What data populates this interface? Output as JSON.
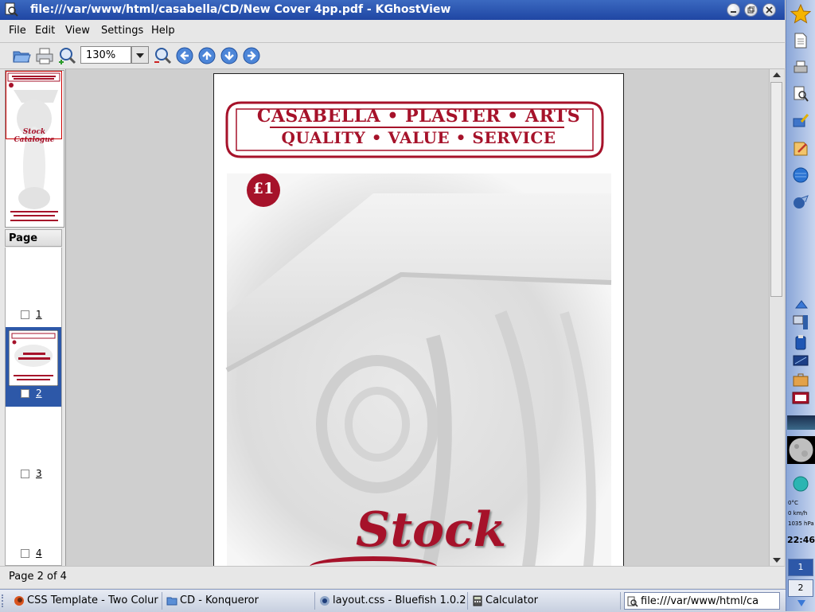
{
  "window": {
    "title": "file:///var/www/html/casabella/CD/New Cover 4pp.pdf - KGhostView"
  },
  "menubar": {
    "items": [
      "File",
      "Edit",
      "View",
      "Settings",
      "Help"
    ]
  },
  "toolbar": {
    "zoom_value": "130%"
  },
  "thumbs": {
    "header": "Page",
    "pages": [
      {
        "label": "1",
        "selected": false
      },
      {
        "label": "2",
        "selected": true
      },
      {
        "label": "3",
        "selected": false
      },
      {
        "label": "4",
        "selected": false
      }
    ]
  },
  "document": {
    "banner_line1": "CASABELLA • PLASTER • ARTS",
    "banner_line2": "QUALITY • VALUE • SERVICE",
    "price": "£1",
    "title_word": "Stock",
    "preview_title": "Stock Catalogue",
    "brand_color": "#a6122a"
  },
  "status": {
    "text": "Page 2 of 4"
  },
  "kicker": {
    "weather_temp": "0°C",
    "weather_wind": "0 km/h",
    "weather_pressure": "1035 hPa",
    "clock": "22:46",
    "desktops": [
      "1",
      "2"
    ]
  },
  "taskbar": {
    "tasks": [
      {
        "label": "CSS Template - Two Colur",
        "icon": "firefox-icon"
      },
      {
        "label": "CD - Konqueror",
        "icon": "folder-icon"
      },
      {
        "label": "layout.css - Bluefish 1.0.2",
        "icon": "bluefish-icon"
      },
      {
        "label": "Calculator",
        "icon": "calculator-icon"
      },
      {
        "label": "file:///var/www/html/ca",
        "icon": "kghostview-icon"
      }
    ]
  }
}
